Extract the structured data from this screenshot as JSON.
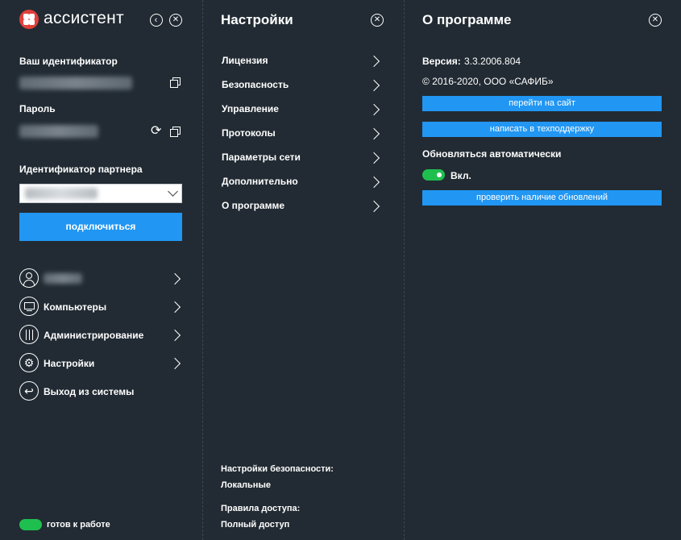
{
  "left": {
    "app_title": "ассистент",
    "id_label": "Ваш идентификатор",
    "password_label": "Пароль",
    "partner_label": "Идентификатор партнера",
    "connect_label": "подключиться",
    "menu": [
      {
        "label": "",
        "icon": "user-icon"
      },
      {
        "label": "Компьютеры",
        "icon": "monitor-icon"
      },
      {
        "label": "Администрирование",
        "icon": "sliders-icon"
      },
      {
        "label": "Настройки",
        "icon": "gears-icon"
      },
      {
        "label": "Выход из системы",
        "icon": "logout-icon"
      }
    ],
    "status": "готов к работе",
    "status_color": "#1fbf4f"
  },
  "middle": {
    "title": "Настройки",
    "items": [
      "Лицензия",
      "Безопасность",
      "Управление",
      "Протоколы",
      "Параметры сети",
      "Дополнительно",
      "О программе"
    ],
    "security_label": "Настройки безопасности:",
    "security_value": "Локальные",
    "access_label": "Правила доступа:",
    "access_value": "Полный доступ"
  },
  "right": {
    "title": "О программе",
    "version_label": "Версия:",
    "version_value": "3.3.2006.804",
    "copyright": "© 2016-2020, ООО «САФИБ»",
    "site_button": "перейти на сайт",
    "support_button": "написать в техподдержку",
    "auto_update_label": "Обновляться автоматически",
    "auto_update_state": "Вкл.",
    "check_updates_button": "проверить наличие обновлений"
  },
  "colors": {
    "background": "#222b33",
    "accent": "#2196f3",
    "logo": "#e0413b"
  }
}
